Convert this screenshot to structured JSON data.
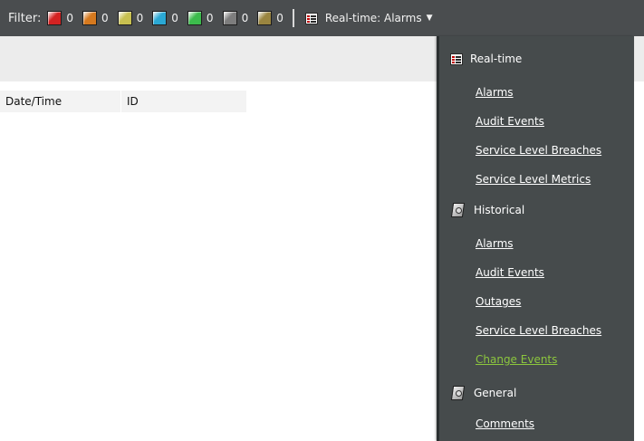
{
  "toolbar": {
    "filter_label": "Filter:",
    "severities": [
      {
        "color": "#d32222",
        "count": "0"
      },
      {
        "color": "#d6791e",
        "count": "0"
      },
      {
        "color": "#c8c050",
        "count": "0"
      },
      {
        "color": "#2aa8d4",
        "count": "0"
      },
      {
        "color": "#3cbb4c",
        "count": "0"
      },
      {
        "color": "#7d7d7d",
        "count": "0"
      },
      {
        "color": "#9a8540",
        "count": "0"
      }
    ],
    "view_selector_label": "Real-time: Alarms",
    "view_selector_icon": "table-icon",
    "caret_icon": "chevron-down-icon"
  },
  "table": {
    "columns": [
      "Date/Time",
      "ID"
    ]
  },
  "menu": {
    "realtime": {
      "label": "Real-time",
      "icon": "table-icon",
      "items": [
        "Alarms",
        "Audit Events",
        "Service Level Breaches",
        "Service Level Metrics"
      ]
    },
    "historical": {
      "label": "Historical",
      "icon": "history-icon",
      "items": [
        "Alarms",
        "Audit Events",
        "Outages",
        "Service Level Breaches",
        "Change Events"
      ]
    },
    "general": {
      "label": "General",
      "icon": "history-icon",
      "items": [
        "Comments"
      ]
    },
    "active_item": "Change Events",
    "active_color": "#8cc63e"
  }
}
